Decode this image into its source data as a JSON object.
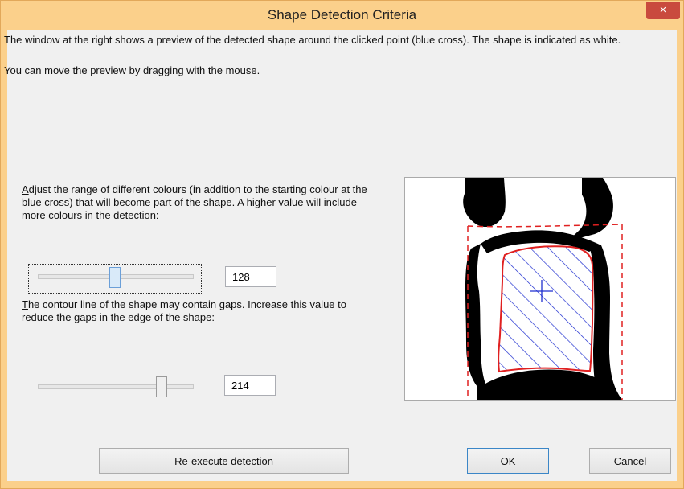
{
  "window": {
    "title": "Shape Detection Criteria",
    "close_label": "×"
  },
  "intro": {
    "line1": "The window at the right shows a preview of the detected shape around the clicked point (blue cross). The shape is indicated as white.",
    "line2": "You can move the preview by dragging with the mouse."
  },
  "colour_range": {
    "label_mnemonic": "A",
    "label_rest": "djust the range of different colours (in addition to the starting colour at the blue cross) that will become part of the shape. A higher value will include more colours in the detection:",
    "value": "128"
  },
  "gap_tolerance": {
    "label_mnemonic": "T",
    "label_rest": "he contour line of the shape may contain gaps. Increase this value to reduce the gaps in the edge of the shape:",
    "value": "214"
  },
  "buttons": {
    "reexecute": {
      "mnemonic": "R",
      "rest": "e-execute detection"
    },
    "ok": {
      "mnemonic": "O",
      "rest": "K"
    },
    "cancel": {
      "mnemonic": "C",
      "rest": "ancel"
    }
  },
  "colors": {
    "frame": "#fbd08b",
    "client": "#f0f0f0",
    "close": "#c94a3e",
    "shape_hatch": "#1f2fd0",
    "contour": "#e02020"
  },
  "icons": {
    "close": "close-icon",
    "cross": "blue-cross-icon"
  }
}
